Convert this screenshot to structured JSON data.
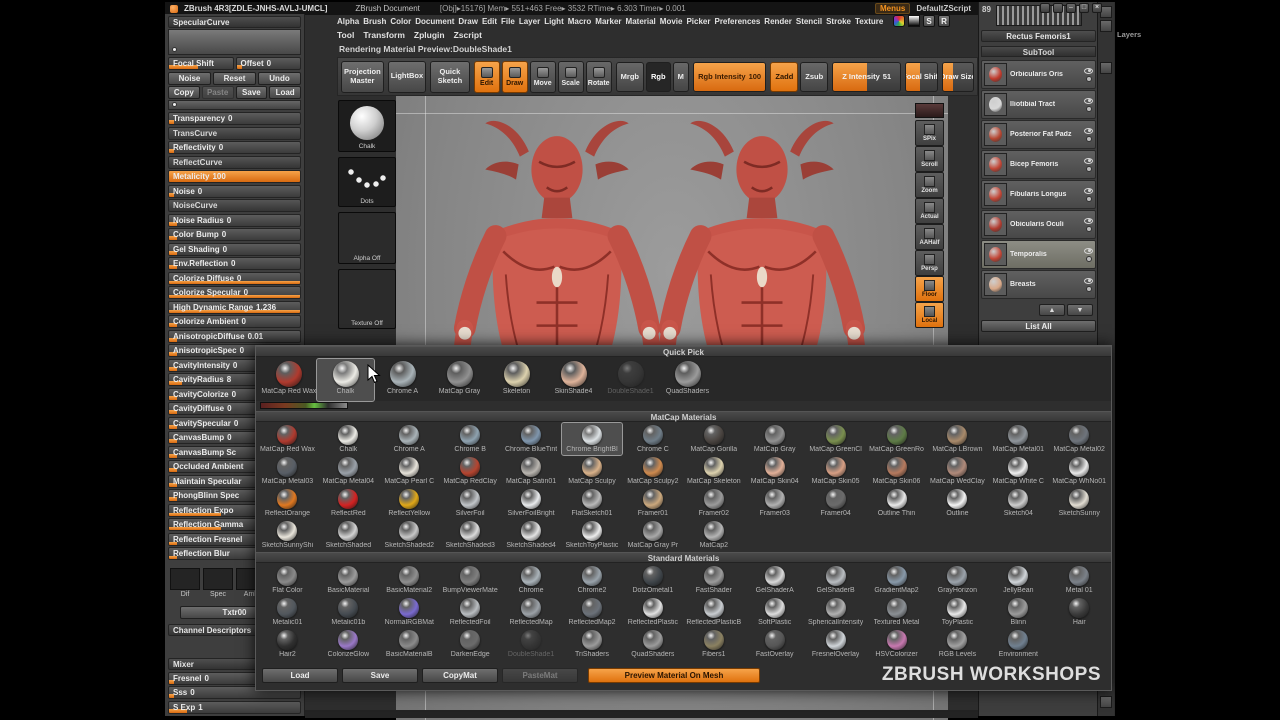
{
  "titlebar": {
    "app_title": "ZBrush 4R3[ZDLE-JNHS-AVLJ-UMCL]",
    "doc_title": "ZBrush Document",
    "stats": "[Obj]▸15176]   Mem▸ 551+463   Free▸ 3532   RTime▸ 6.303   Timer▸ 0.001",
    "menus": "Menus",
    "zscript": "DefaultZScript"
  },
  "menubar": {
    "items": [
      "Alpha",
      "Brush",
      "Color",
      "Document",
      "Draw",
      "Edit",
      "File",
      "Layer",
      "Light",
      "Macro",
      "Marker",
      "Material",
      "Movie",
      "Picker",
      "Preferences",
      "Render",
      "Stencil",
      "Stroke",
      "Texture"
    ],
    "s_label": "S",
    "r_label": "R"
  },
  "menubar2": {
    "items": [
      "Tool",
      "Transform",
      "Zplugin",
      "Zscript"
    ]
  },
  "render_status": "Rendering Material Preview:DoubleShade1",
  "toolbar": {
    "projection_master": "Projection Master",
    "lightbox": "LightBox",
    "quick_sketch": "Quick Sketch",
    "modes": [
      {
        "name": "Edit",
        "on": true
      },
      {
        "name": "Draw",
        "on": true
      },
      {
        "name": "Move"
      },
      {
        "name": "Scale"
      },
      {
        "name": "Rotate"
      }
    ],
    "color_modes": [
      {
        "name": "Mrgb"
      },
      {
        "name": "Rgb",
        "on": true
      },
      {
        "name": "M"
      }
    ],
    "rgb_intensity_label": "Rgb Intensity",
    "rgb_intensity_value": "100",
    "rgb_intensity_fill": "100%",
    "sculpt_modes": [
      {
        "name": "Zadd",
        "on": true
      },
      {
        "name": "Zsub"
      }
    ],
    "z_intensity_label": "Z Intensity",
    "z_intensity_value": "51",
    "z_intensity_fill": "51%",
    "focal_shift": "Focal Shift",
    "focal_fill": "45%",
    "draw_size": "Draw Size",
    "draw_fill": "35%"
  },
  "left_panel": {
    "specular_curve": "SpecularCurve",
    "mini_sliders": [
      {
        "label": "Focal Shift",
        "value": "",
        "fill": "45%"
      },
      {
        "label": "Offset",
        "value": "0",
        "fill": "8%"
      }
    ],
    "buttons_row1": [
      {
        "name": "Noise"
      },
      {
        "name": "Reset"
      },
      {
        "name": "Undo"
      }
    ],
    "buttons_row2": [
      {
        "name": "Copy"
      },
      {
        "name": "Paste",
        "dimmed": true
      },
      {
        "name": "Save"
      },
      {
        "name": "Load"
      }
    ],
    "sliders": [
      {
        "label": "Transparency",
        "value": "0",
        "fill": "4%"
      },
      {
        "label": "TransCurve",
        "curve": true
      },
      {
        "label": "Reflectivity",
        "value": "0",
        "fill": "4%"
      },
      {
        "label": "ReflectCurve",
        "curve": true
      },
      {
        "label": "Metalicity",
        "value": "100",
        "fill": "100%",
        "on": true
      },
      {
        "label": "Noise",
        "value": "0",
        "fill": "4%"
      },
      {
        "label": "NoiseCurve",
        "curve": true
      },
      {
        "label": "Noise Radius",
        "value": "0",
        "fill": "6%"
      },
      {
        "label": "Color Bump",
        "value": "0",
        "fill": "6%"
      },
      {
        "label": "Gel Shading",
        "value": "0",
        "fill": "6%"
      },
      {
        "label": "Env.Reflection",
        "value": "0",
        "fill": "6%"
      },
      {
        "label": "Colorize Diffuse",
        "value": "0",
        "fill": "100%",
        "accent": true
      },
      {
        "label": "Colorize Specular",
        "value": "0",
        "fill": "100%",
        "accent": true
      },
      {
        "label": "High Dynamic Range",
        "value": "1.236",
        "fill": "100%",
        "accent": true
      },
      {
        "label": "Colorize Ambient",
        "value": "0",
        "fill": "6%"
      },
      {
        "label": "AnisotropicDiffuse",
        "value": "0.01",
        "fill": "6%"
      },
      {
        "label": "AnisotropicSpec",
        "value": "0",
        "fill": "6%"
      },
      {
        "label": "CavityIntensity",
        "value": "0",
        "fill": "6%"
      },
      {
        "label": "CavityRadius",
        "value": "8",
        "fill": "10%"
      },
      {
        "label": "CavityColorize",
        "value": "0",
        "fill": "6%"
      },
      {
        "label": "CavityDiffuse",
        "value": "0",
        "fill": "6%"
      },
      {
        "label": "CavitySpecular",
        "value": "0",
        "fill": "6%"
      },
      {
        "label": "CanvasBump",
        "value": "0",
        "fill": "6%"
      },
      {
        "label": "CanvasBump Sc",
        "value": "",
        "fill": "6%"
      },
      {
        "label": "Occluded Ambient",
        "value": "",
        "fill": "6%"
      },
      {
        "label": "Maintain Specular",
        "value": "",
        "fill": "6%"
      },
      {
        "label": "PhongBlinn Spec",
        "value": "",
        "fill": "6%"
      },
      {
        "label": "Reflection Expo",
        "value": "",
        "fill": "40%",
        "accent": true
      },
      {
        "label": "Reflection Gamma",
        "value": "",
        "fill": "40%",
        "accent": true
      },
      {
        "label": "Reflection Fresnel",
        "value": "",
        "fill": "6%",
        "accent": true
      },
      {
        "label": "Reflection Blur",
        "value": "",
        "fill": "6%",
        "accent": true
      }
    ],
    "channel_thumbs": [
      {
        "name": "Dif"
      },
      {
        "name": "Spec"
      },
      {
        "name": "Amb"
      }
    ],
    "txtr_button": "Txtr00",
    "channel_descriptors": "Channel Descriptors"
  },
  "mixer": {
    "title": "Mixer",
    "sliders": [
      {
        "label": "Fresnel",
        "value": "0",
        "fill": "4%"
      },
      {
        "label": "Sss",
        "value": "0",
        "fill": "4%"
      },
      {
        "label": "S Exp",
        "value": "1",
        "fill": "14%"
      }
    ]
  },
  "tool_strip": {
    "material_label": "Chalk",
    "stroke_label": "Dots",
    "alpha_label": "Alpha Off",
    "texture_label": "Texture Off"
  },
  "view_icons": [
    {
      "name": "SPix"
    },
    {
      "name": "Scroll"
    },
    {
      "name": "Zoom"
    },
    {
      "name": "Actual"
    },
    {
      "name": "AAHalf"
    },
    {
      "name": "Persp"
    },
    {
      "name": "Floor",
      "on": true
    },
    {
      "name": "Local",
      "on": true
    }
  ],
  "right_panel": {
    "count": "89",
    "tool_name": "Rectus Femoris1",
    "subtool_title": "SubTool",
    "items": [
      {
        "name": "Orbicularis Oris",
        "color": "#c0392b"
      },
      {
        "name": "Iliotibial Tract",
        "color": "#d8d8d8"
      },
      {
        "name": "Posterior Fat Padz",
        "color": "#b5442f"
      },
      {
        "name": "Bicep Femoris",
        "color": "#c14434"
      },
      {
        "name": "Fibularis Longus",
        "color": "#c14434"
      },
      {
        "name": "Obicularis Oculi",
        "color": "#b03a2e"
      },
      {
        "name": "Temporalis",
        "color": "#c14434",
        "selected": true
      },
      {
        "name": "Breasts",
        "color": "#d8a888"
      }
    ],
    "arrow_up": "▲",
    "arrow_down": "▼",
    "list_all": "List All",
    "layers_label": "Layers"
  },
  "overlay": {
    "quick_pick_title": "Quick Pick",
    "quick_pick": [
      {
        "name": "MatCap Red Wax",
        "color": "#b03a2e"
      },
      {
        "name": "Chalk",
        "color": "#ecebe5",
        "selected": true
      },
      {
        "name": "Chrome A",
        "color": "#a9b3b8"
      },
      {
        "name": "MatCap Gray",
        "color": "#919191"
      },
      {
        "name": "Skeleton",
        "color": "#ddd2ae"
      },
      {
        "name": "SkinShade4",
        "color": "#dfb39a"
      },
      {
        "name": "DoubleShade1",
        "color": "#4a4a4a",
        "dimmed": true
      },
      {
        "name": "QuadShaders",
        "color": "#9b9b9b"
      }
    ],
    "matcap_title": "MatCap Materials",
    "matcaps": [
      {
        "name": "MatCap Red Wax",
        "color": "#b03a2e"
      },
      {
        "name": "Chalk",
        "color": "#ecebe5"
      },
      {
        "name": "Chrome A",
        "color": "#a9b3b8"
      },
      {
        "name": "Chrome B",
        "color": "#8ea2b0"
      },
      {
        "name": "Chrome BlueTint",
        "color": "#7f96ad"
      },
      {
        "name": "Chrome BrightBl",
        "color": "#dde2e5",
        "selected": true
      },
      {
        "name": "Chrome C",
        "color": "#6f7d88"
      },
      {
        "name": "MatCap Gorilla",
        "color": "#4a4440"
      },
      {
        "name": "MatCap Gray",
        "color": "#919191"
      },
      {
        "name": "MatCap GreenCl",
        "color": "#7a8f4e"
      },
      {
        "name": "MatCap GreenRo",
        "color": "#5e7c46"
      },
      {
        "name": "MatCap LBrown",
        "color": "#a98a6a"
      },
      {
        "name": "MatCap Metal01",
        "color": "#8f959b"
      },
      {
        "name": "MatCap Metal02",
        "color": "#6e747c"
      },
      {
        "name": "MatCap Metal03",
        "color": "#585e66"
      },
      {
        "name": "MatCap Metal04",
        "color": "#9aa1a9"
      },
      {
        "name": "MatCap Pearl C",
        "color": "#e7e3da"
      },
      {
        "name": "MatCap RedClay",
        "color": "#b5442f"
      },
      {
        "name": "MatCap Satin01",
        "color": "#b9b5af"
      },
      {
        "name": "MatCap Sculpy",
        "color": "#d9b189"
      },
      {
        "name": "MatCap Sculpy2",
        "color": "#cf8a4e"
      },
      {
        "name": "MatCap Skeleton",
        "color": "#ddd2ae"
      },
      {
        "name": "MatCap Skin04",
        "color": "#e2b098"
      },
      {
        "name": "MatCap Skin05",
        "color": "#d79f84"
      },
      {
        "name": "MatCap Skin06",
        "color": "#b67a5e"
      },
      {
        "name": "MatCap WedClay",
        "color": "#b08a7a"
      },
      {
        "name": "MatCap White C",
        "color": "#f0f0f0"
      },
      {
        "name": "MatCap WhNo01",
        "color": "#e9e9e9"
      },
      {
        "name": "ReflectOrange",
        "color": "#e07820"
      },
      {
        "name": "ReflectRed",
        "color": "#d42222"
      },
      {
        "name": "ReflectYellow",
        "color": "#e0a818"
      },
      {
        "name": "SilverFoil",
        "color": "#c1c5c9"
      },
      {
        "name": "SilverFoilBright",
        "color": "#e9ebed"
      },
      {
        "name": "FlatSketch01",
        "color": "#b9b9b9"
      },
      {
        "name": "Framer01",
        "color": "#cba87d"
      },
      {
        "name": "Framer02",
        "color": "#9b9b9b"
      },
      {
        "name": "Framer03",
        "color": "#b1b1b1"
      },
      {
        "name": "Framer04",
        "color": "#6b6b6b"
      },
      {
        "name": "Outline Thin",
        "color": "#e9e9e9"
      },
      {
        "name": "Outline",
        "color": "#f4f4f4"
      },
      {
        "name": "Sketch04",
        "color": "#cdcdcd"
      },
      {
        "name": "SketchSunny",
        "color": "#e3ded3"
      },
      {
        "name": "SketchSunnyShi",
        "color": "#e9e5db"
      },
      {
        "name": "SketchShaded",
        "color": "#d3d3d3"
      },
      {
        "name": "SketchShaded2",
        "color": "#c7c7c7"
      },
      {
        "name": "SketchShaded3",
        "color": "#dbdbdb"
      },
      {
        "name": "SketchShaded4",
        "color": "#e3e3e3"
      },
      {
        "name": "SketchToyPlastic",
        "color": "#ededed"
      },
      {
        "name": "MatCap Gray Pr",
        "color": "#a9a9a9"
      },
      {
        "name": "MatCap2",
        "color": "#b5b5b5"
      }
    ],
    "standard_title": "Standard Materials",
    "standards": [
      {
        "name": "Flat Color",
        "color": "#8a8a8a"
      },
      {
        "name": "BasicMaterial",
        "color": "#9b9b9b"
      },
      {
        "name": "BasicMaterial2",
        "color": "#8f8f8f"
      },
      {
        "name": "BumpViewerMate",
        "color": "#7f7f7f"
      },
      {
        "name": "Chrome",
        "color": "#aab3b9"
      },
      {
        "name": "Chrome2",
        "color": "#99a3ab"
      },
      {
        "name": "DotzOmetal1",
        "color": "#3f454a"
      },
      {
        "name": "FastShader",
        "color": "#9b9b9b"
      },
      {
        "name": "GelShaderA",
        "color": "#d9d9d9"
      },
      {
        "name": "GelShaderB",
        "color": "#b9bdc1"
      },
      {
        "name": "GradientMap2",
        "color": "#8899a9"
      },
      {
        "name": "GrayHorizon",
        "color": "#9ba3ab"
      },
      {
        "name": "JellyBean",
        "color": "#d0d5d9"
      },
      {
        "name": "Metal 01",
        "color": "#7b8189"
      },
      {
        "name": "Metalic01",
        "color": "#51575d"
      },
      {
        "name": "Metalic01b",
        "color": "#454b51"
      },
      {
        "name": "NormalRGBMat",
        "color": "#7a6ad0"
      },
      {
        "name": "ReflectedFoil",
        "color": "#b9bdc1"
      },
      {
        "name": "ReflectedMap",
        "color": "#9ba1a7"
      },
      {
        "name": "ReflectedMap2",
        "color": "#6b7179"
      },
      {
        "name": "ReflectedPlastic",
        "color": "#e1e1e1"
      },
      {
        "name": "ReflectedPlasticB",
        "color": "#c9cdd1"
      },
      {
        "name": "SoftPlastic",
        "color": "#dddddd"
      },
      {
        "name": "SphericalIntensity",
        "color": "#b1b1b1"
      },
      {
        "name": "Textured Metal",
        "color": "#8b9095"
      },
      {
        "name": "ToyPlastic",
        "color": "#e9e9e9"
      },
      {
        "name": "Blinn",
        "color": "#9b9b9b"
      },
      {
        "name": "Hair",
        "color": "#3b3b3b"
      },
      {
        "name": "Hair2",
        "color": "#303030"
      },
      {
        "name": "ColorizeGlow",
        "color": "#9a78c8"
      },
      {
        "name": "BasicMaterialB",
        "color": "#8b8b8b"
      },
      {
        "name": "DarkenEdge",
        "color": "#6b6b6b"
      },
      {
        "name": "DoubleShade1",
        "color": "#3f3f3f",
        "dimmed": true
      },
      {
        "name": "TriShaders",
        "color": "#9b9b9b"
      },
      {
        "name": "QuadShaders",
        "color": "#9b9b9b"
      },
      {
        "name": "Fibers1",
        "color": "#8b8161"
      },
      {
        "name": "FastOverlay",
        "color": "#565656"
      },
      {
        "name": "FresnelOverlay",
        "color": "#d0d5d9"
      },
      {
        "name": "HSVColorizer",
        "color": "#c878b0"
      },
      {
        "name": "RGB Levels",
        "color": "#a1a1a1"
      },
      {
        "name": "Environment",
        "color": "#708090"
      }
    ],
    "buttons": [
      {
        "name": "Load"
      },
      {
        "name": "Save"
      },
      {
        "name": "CopyMat"
      },
      {
        "name": "PasteMat",
        "dimmed": true
      }
    ],
    "preview_button": "Preview Material On Mesh",
    "watermark": "ZBRUSH WORKSHOPS"
  }
}
